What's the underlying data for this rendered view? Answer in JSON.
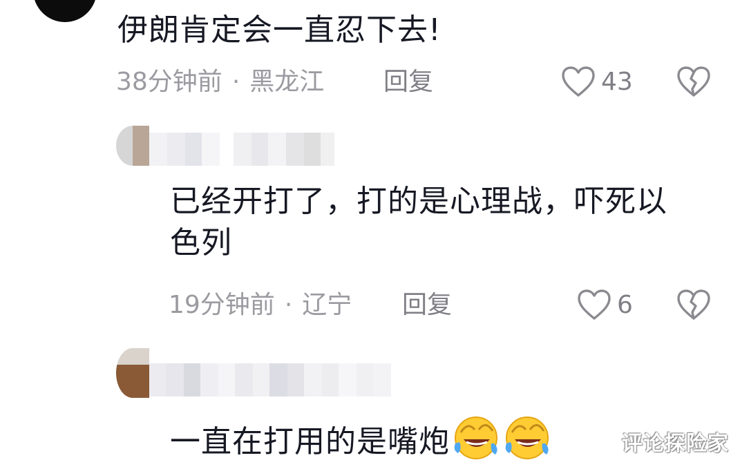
{
  "comments": [
    {
      "text": "伊朗肯定会一直忍下去!",
      "time": "38分钟前",
      "separator": "·",
      "location": "黑龙江",
      "reply_label": "回复",
      "like_count": "43"
    },
    {
      "text": "已经开打了，打的是心理战，吓死以色列",
      "time": "19分钟前",
      "separator": "·",
      "location": "辽宁",
      "reply_label": "回复",
      "like_count": "6"
    },
    {
      "text": "一直在打用的是嘴炮"
    }
  ],
  "watermark": "评论探险家",
  "icons": {
    "like": "heart-outline-icon",
    "dislike": "broken-heart-icon",
    "emoji": "rolling-on-floor-laughing-emoji"
  }
}
